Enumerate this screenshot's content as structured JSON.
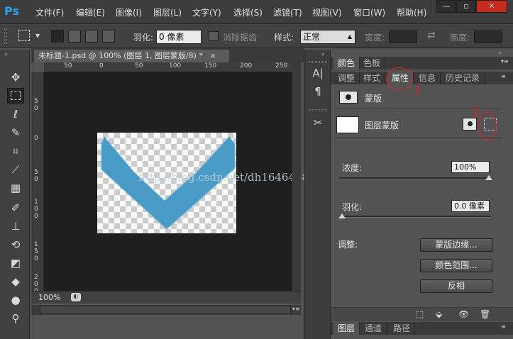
{
  "app": {
    "logo": "Ps"
  },
  "menu": [
    "文件(F)",
    "编辑(E)",
    "图像(I)",
    "图层(L)",
    "文字(Y)",
    "选择(S)",
    "滤镜(T)",
    "视图(V)",
    "窗口(W)",
    "帮助(H)"
  ],
  "window_controls": {
    "minimize": "—",
    "restore": "▫",
    "close": "✕"
  },
  "options": {
    "feather_label": "羽化:",
    "feather_value": "0 像素",
    "antialias_label": "消除锯齿",
    "style_label": "样式:",
    "style_value": "正常",
    "width_label": "宽度:",
    "height_label": "高度:"
  },
  "document": {
    "tab_title": "未标题-1.psd @ 100% (图层 1, 图层蒙版/8) *",
    "close": "×",
    "zoom": "100%",
    "ruler_top": [
      "50",
      "0",
      "50",
      "100",
      "150",
      "200",
      "250"
    ],
    "ruler_left": [
      "5\n0",
      "0",
      "5\n0",
      "1\n0\n0",
      "1\n5\n0",
      "2\n0\n0"
    ],
    "shape_color": "#4a9cc7",
    "watermark": "http://blog.csdn.net/dh164645822"
  },
  "panels": {
    "top_tabs": [
      "颜色",
      "色板"
    ],
    "tabs": [
      "调整",
      "样式",
      "属性",
      "信息",
      "历史记录"
    ],
    "active_tab": "属性",
    "mask_section_label": "蒙版",
    "layer_mask_label": "图层蒙版",
    "density_label": "浓度:",
    "density_value": "100%",
    "feather_label": "羽化:",
    "feather_value": "0.0 像素",
    "adjust_label": "调整:",
    "buttons": [
      "蒙版边缘...",
      "颜色范围...",
      "反相"
    ],
    "bottom_tabs": [
      "图层",
      "通道",
      "路径"
    ],
    "annotations": [
      "1",
      "2"
    ]
  },
  "colors": {
    "accent": "#29a3ec",
    "annotation": "#e02020"
  }
}
